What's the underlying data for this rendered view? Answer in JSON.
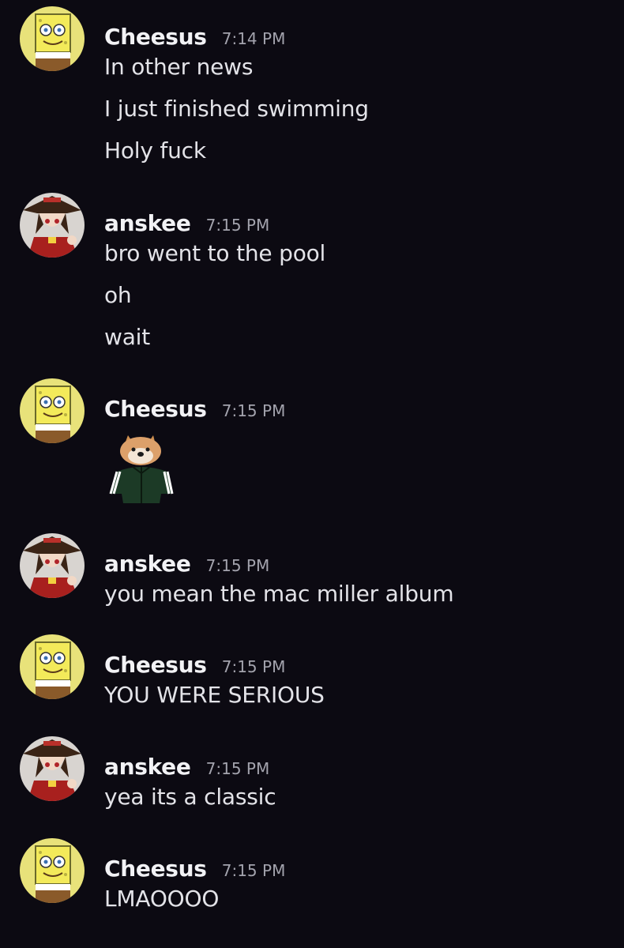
{
  "messages": [
    {
      "user": "Cheesus",
      "time": "7:14 PM",
      "avatar": "spongebob-avatar",
      "lines": [
        "In other news",
        "I just finished swimming",
        "Holy fuck"
      ]
    },
    {
      "user": "anskee",
      "time": "7:15 PM",
      "avatar": "anime-girl-avatar",
      "lines": [
        "bro went to the pool",
        "oh",
        "wait"
      ]
    },
    {
      "user": "Cheesus",
      "time": "7:15 PM",
      "avatar": "spongebob-avatar",
      "sticker": "doge-tracksuit-sticker"
    },
    {
      "user": "anskee",
      "time": "7:15 PM",
      "avatar": "anime-girl-avatar",
      "lines": [
        "you mean the mac miller album"
      ]
    },
    {
      "user": "Cheesus",
      "time": "7:15 PM",
      "avatar": "spongebob-avatar",
      "lines": [
        "YOU WERE SERIOUS"
      ]
    },
    {
      "user": "anskee",
      "time": "7:15 PM",
      "avatar": "anime-girl-avatar",
      "lines": [
        "yea its a classic"
      ]
    },
    {
      "user": "Cheesus",
      "time": "7:15 PM",
      "avatar": "spongebob-avatar",
      "lines": [
        "LMAOOOO"
      ]
    }
  ],
  "colors": {
    "background": "#0c0a12",
    "username": "#f2f2f5",
    "timestamp": "#a3a3ad",
    "text": "#e3e3e8"
  }
}
